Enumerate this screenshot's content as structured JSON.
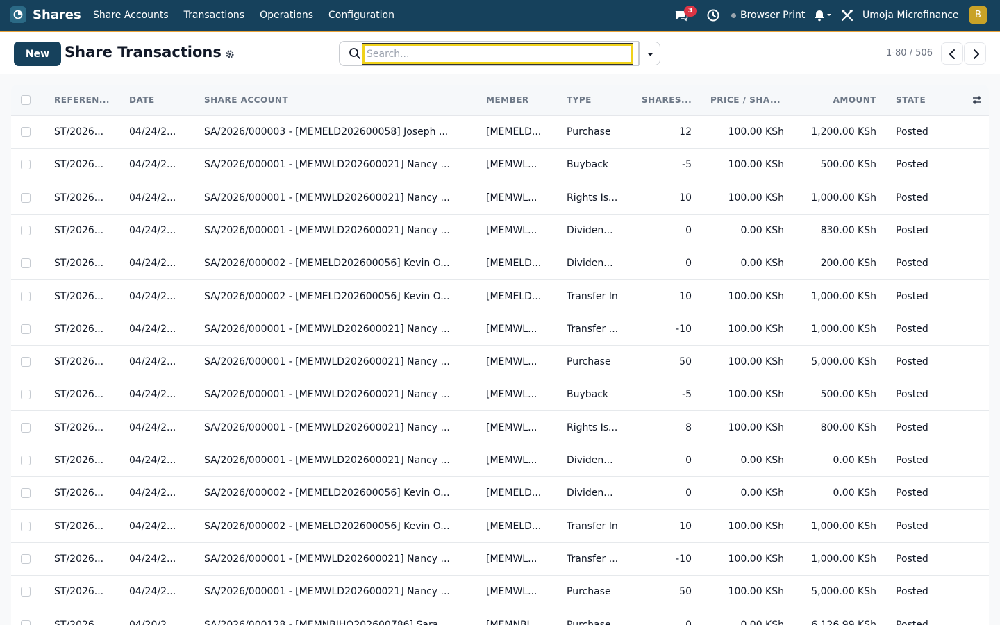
{
  "navbar": {
    "brand": "Shares",
    "menu": [
      "Share Accounts",
      "Transactions",
      "Operations",
      "Configuration"
    ],
    "chat_badge": "3",
    "printer": "Browser Print",
    "company": "Umoja Microfinance",
    "avatar_initial": "B",
    "icons": [
      "app-icon",
      "chat-icon",
      "clock-icon",
      "bell-icon",
      "chevron-down-icon",
      "tools-icon"
    ]
  },
  "control": {
    "new_label": "New",
    "title": "Share Transactions",
    "search_placeholder": "Search...",
    "pager": "1-80 / 506"
  },
  "table": {
    "headers": [
      "REFEREN...",
      "DATE",
      "SHARE ACCOUNT",
      "MEMBER",
      "TYPE",
      "SHARES...",
      "PRICE / SHA...",
      "AMOUNT",
      "STATE"
    ],
    "rows": [
      {
        "ref": "ST/2026...",
        "date": "04/24/2...",
        "account": "SA/2026/000003 - [MEMELD202600058] Joseph ...",
        "member": "[MEMELD...",
        "type": "Purchase",
        "shares": "12",
        "price": "100.00 KSh",
        "amount": "1,200.00 KSh",
        "state": "Posted"
      },
      {
        "ref": "ST/2026...",
        "date": "04/24/2...",
        "account": "SA/2026/000001 - [MEMWLD202600021] Nancy ...",
        "member": "[MEMWL...",
        "type": "Buyback",
        "shares": "-5",
        "price": "100.00 KSh",
        "amount": "500.00 KSh",
        "state": "Posted"
      },
      {
        "ref": "ST/2026...",
        "date": "04/24/2...",
        "account": "SA/2026/000001 - [MEMWLD202600021] Nancy ...",
        "member": "[MEMWL...",
        "type": "Rights Is...",
        "shares": "10",
        "price": "100.00 KSh",
        "amount": "1,000.00 KSh",
        "state": "Posted"
      },
      {
        "ref": "ST/2026...",
        "date": "04/24/2...",
        "account": "SA/2026/000001 - [MEMWLD202600021] Nancy ...",
        "member": "[MEMWL...",
        "type": "Dividen...",
        "shares": "0",
        "price": "0.00 KSh",
        "amount": "830.00 KSh",
        "state": "Posted"
      },
      {
        "ref": "ST/2026...",
        "date": "04/24/2...",
        "account": "SA/2026/000002 - [MEMELD202600056] Kevin O...",
        "member": "[MEMELD...",
        "type": "Dividen...",
        "shares": "0",
        "price": "0.00 KSh",
        "amount": "200.00 KSh",
        "state": "Posted"
      },
      {
        "ref": "ST/2026...",
        "date": "04/24/2...",
        "account": "SA/2026/000002 - [MEMELD202600056] Kevin O...",
        "member": "[MEMELD...",
        "type": "Transfer In",
        "shares": "10",
        "price": "100.00 KSh",
        "amount": "1,000.00 KSh",
        "state": "Posted"
      },
      {
        "ref": "ST/2026...",
        "date": "04/24/2...",
        "account": "SA/2026/000001 - [MEMWLD202600021] Nancy ...",
        "member": "[MEMWL...",
        "type": "Transfer ...",
        "shares": "-10",
        "price": "100.00 KSh",
        "amount": "1,000.00 KSh",
        "state": "Posted"
      },
      {
        "ref": "ST/2026...",
        "date": "04/24/2...",
        "account": "SA/2026/000001 - [MEMWLD202600021] Nancy ...",
        "member": "[MEMWL...",
        "type": "Purchase",
        "shares": "50",
        "price": "100.00 KSh",
        "amount": "5,000.00 KSh",
        "state": "Posted"
      },
      {
        "ref": "ST/2026...",
        "date": "04/24/2...",
        "account": "SA/2026/000001 - [MEMWLD202600021] Nancy ...",
        "member": "[MEMWL...",
        "type": "Buyback",
        "shares": "-5",
        "price": "100.00 KSh",
        "amount": "500.00 KSh",
        "state": "Posted"
      },
      {
        "ref": "ST/2026...",
        "date": "04/24/2...",
        "account": "SA/2026/000001 - [MEMWLD202600021] Nancy ...",
        "member": "[MEMWL...",
        "type": "Rights Is...",
        "shares": "8",
        "price": "100.00 KSh",
        "amount": "800.00 KSh",
        "state": "Posted"
      },
      {
        "ref": "ST/2026...",
        "date": "04/24/2...",
        "account": "SA/2026/000001 - [MEMWLD202600021] Nancy ...",
        "member": "[MEMWL...",
        "type": "Dividen...",
        "shares": "0",
        "price": "0.00 KSh",
        "amount": "0.00 KSh",
        "state": "Posted"
      },
      {
        "ref": "ST/2026...",
        "date": "04/24/2...",
        "account": "SA/2026/000002 - [MEMELD202600056] Kevin O...",
        "member": "[MEMELD...",
        "type": "Dividen...",
        "shares": "0",
        "price": "0.00 KSh",
        "amount": "0.00 KSh",
        "state": "Posted"
      },
      {
        "ref": "ST/2026...",
        "date": "04/24/2...",
        "account": "SA/2026/000002 - [MEMELD202600056] Kevin O...",
        "member": "[MEMELD...",
        "type": "Transfer In",
        "shares": "10",
        "price": "100.00 KSh",
        "amount": "1,000.00 KSh",
        "state": "Posted"
      },
      {
        "ref": "ST/2026...",
        "date": "04/24/2...",
        "account": "SA/2026/000001 - [MEMWLD202600021] Nancy ...",
        "member": "[MEMWL...",
        "type": "Transfer ...",
        "shares": "-10",
        "price": "100.00 KSh",
        "amount": "1,000.00 KSh",
        "state": "Posted"
      },
      {
        "ref": "ST/2026...",
        "date": "04/24/2...",
        "account": "SA/2026/000001 - [MEMWLD202600021] Nancy ...",
        "member": "[MEMWL...",
        "type": "Purchase",
        "shares": "50",
        "price": "100.00 KSh",
        "amount": "5,000.00 KSh",
        "state": "Posted"
      },
      {
        "ref": "ST/2026...",
        "date": "04/20/2...",
        "account": "SA/2026/000128 - [MEMNBIHQ202600786] Sara...",
        "member": "[MEMNBI...",
        "type": "Purchase",
        "shares": "0",
        "price": "0.00 KSh",
        "amount": "6,126.99 KSh",
        "state": "Posted"
      }
    ]
  },
  "colors": {
    "navbar_bg": "#16415c",
    "navbar_accent": "#e8a33a",
    "primary_button": "#16415c",
    "badge": "#dc3545",
    "avatar": "#c9a227",
    "search_focus": "#f0d21b"
  }
}
